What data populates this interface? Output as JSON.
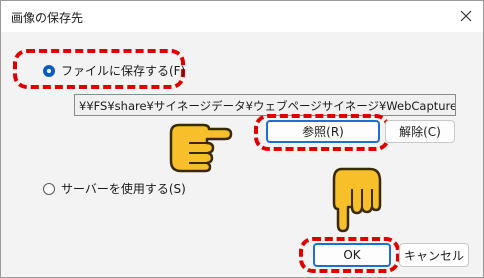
{
  "window": {
    "title": "画像の保存先"
  },
  "options": {
    "file_label": "ファイルに保存する(F)",
    "server_label": "サーバーを使用する(S)"
  },
  "path": {
    "value": "¥¥FS¥share¥サイネージデータ¥ウェブページサイネージ¥WebCapture.nadri"
  },
  "buttons": {
    "browse": "参照(R)",
    "clear": "解除(C)",
    "ok": "OK",
    "cancel": "キャンセル"
  },
  "colors": {
    "accent": "#1f6fd1",
    "highlight": "#e00000",
    "hand": "#f7c02b"
  },
  "icons": [
    "close-icon",
    "pointing-right-hand-icon",
    "pointing-down-hand-icon"
  ]
}
